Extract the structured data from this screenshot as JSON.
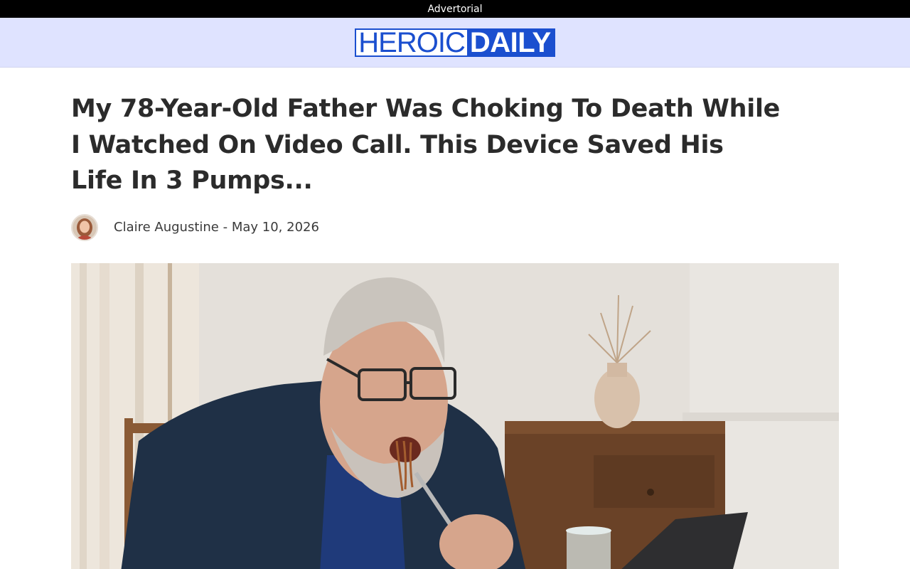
{
  "topbar": {
    "label": "Advertorial"
  },
  "masthead": {
    "logo_part1": "HEROIC",
    "logo_part2": "DAILY",
    "brand_color": "#1b4fcf",
    "background": "#dfe3ff"
  },
  "article": {
    "headline": "My 78-Year-Old Father Was Choking To Death While I Watched On Video Call. This Device Saved His Life In 3 Pumps...",
    "byline": {
      "author": "Claire Augustine",
      "separator": " - ",
      "date": "May 10, 2026"
    }
  }
}
